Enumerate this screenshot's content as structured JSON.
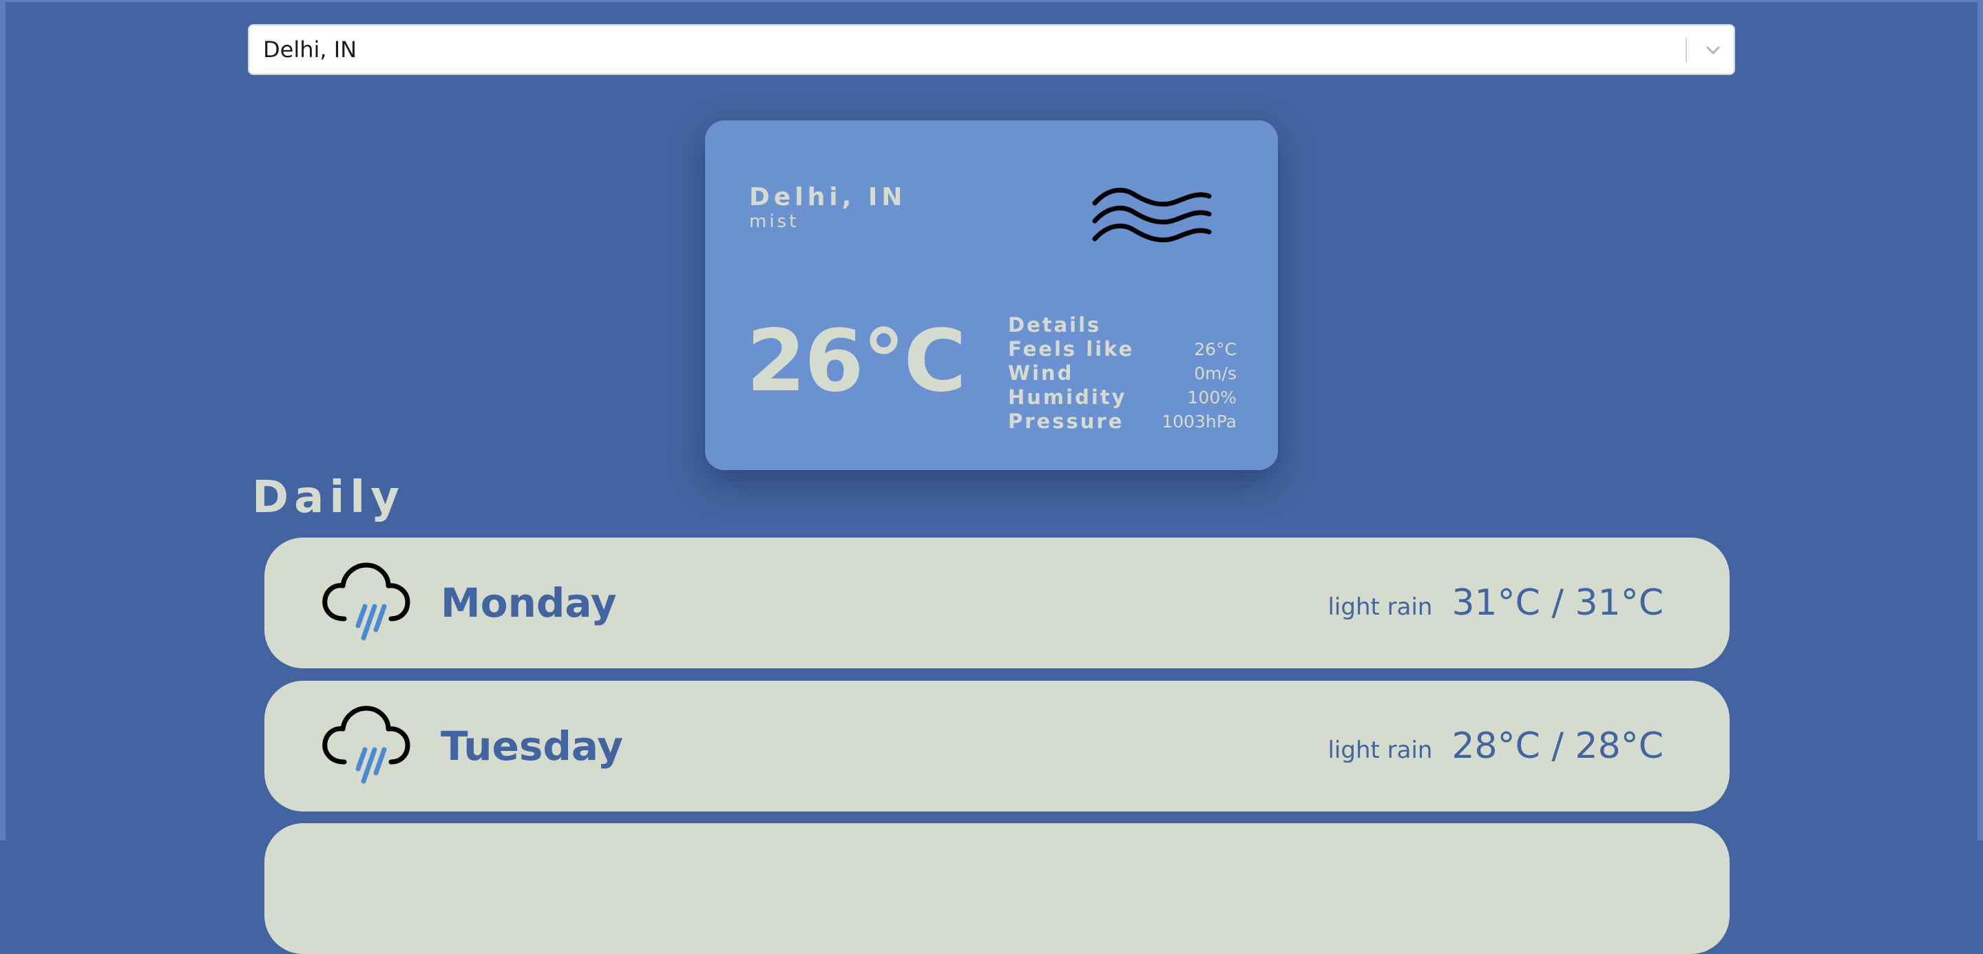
{
  "search": {
    "value": "Delhi, IN"
  },
  "current": {
    "city": "Delhi, IN",
    "description": "mist",
    "temperature": "26°C",
    "details_title": "Details",
    "details": [
      {
        "label": "Feels like",
        "value": "26°C"
      },
      {
        "label": "Wind",
        "value": "0m/s"
      },
      {
        "label": "Humidity",
        "value": "100%"
      },
      {
        "label": "Pressure",
        "value": "1003hPa"
      }
    ],
    "icon": "mist-icon"
  },
  "daily": {
    "title": "Daily",
    "days": [
      {
        "name": "Monday",
        "description": "light rain",
        "temps": "31°C / 31°C",
        "icon": "rain-cloud-icon"
      },
      {
        "name": "Tuesday",
        "description": "light rain",
        "temps": "28°C / 28°C",
        "icon": "rain-cloud-icon"
      }
    ]
  },
  "colors": {
    "background": "#4265a1",
    "card": "#6b92d0",
    "row": "#d5dccd",
    "text_light": "#d6dccd",
    "text_dark": "#4265a1",
    "rain": "#4a8ad4"
  }
}
